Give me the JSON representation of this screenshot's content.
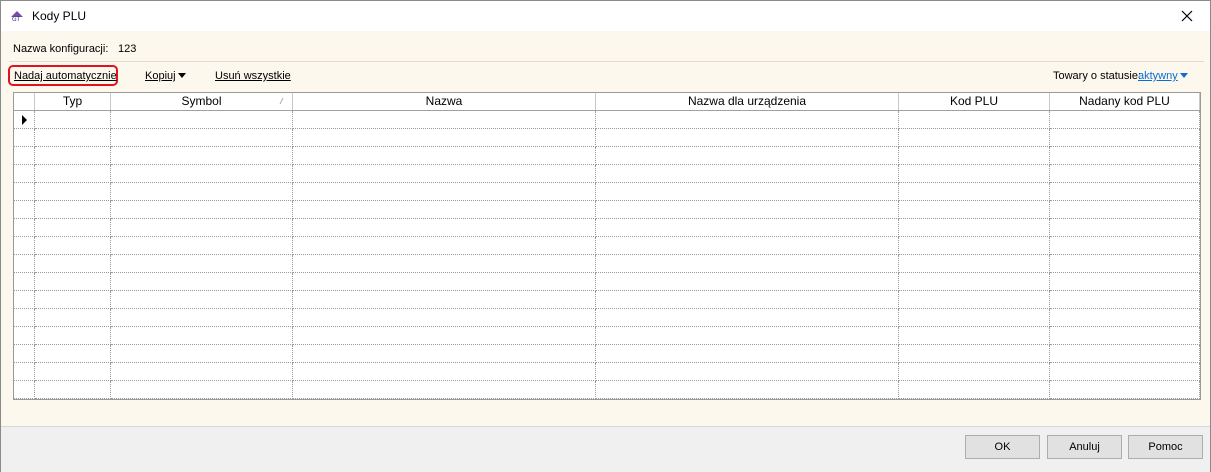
{
  "window": {
    "title": "Kody PLU"
  },
  "config": {
    "label": "Nazwa konfiguracji:",
    "value": "123"
  },
  "toolbar": {
    "assign_auto": "Nadaj automatycznie",
    "copy": "Kopiuj",
    "remove_all": "Usuń wszystkie",
    "status_label": "Towary o statusie:",
    "status_value": "aktywny"
  },
  "grid": {
    "columns": [
      "Typ",
      "Symbol",
      "Nazwa",
      "Nazwa dla urządzenia",
      "Kod PLU",
      "Nadany kod PLU"
    ],
    "rows": [
      [
        "",
        "",
        "",
        "",
        "",
        ""
      ],
      [
        "",
        "",
        "",
        "",
        "",
        ""
      ],
      [
        "",
        "",
        "",
        "",
        "",
        ""
      ],
      [
        "",
        "",
        "",
        "",
        "",
        ""
      ],
      [
        "",
        "",
        "",
        "",
        "",
        ""
      ],
      [
        "",
        "",
        "",
        "",
        "",
        ""
      ],
      [
        "",
        "",
        "",
        "",
        "",
        ""
      ],
      [
        "",
        "",
        "",
        "",
        "",
        ""
      ],
      [
        "",
        "",
        "",
        "",
        "",
        ""
      ],
      [
        "",
        "",
        "",
        "",
        "",
        ""
      ],
      [
        "",
        "",
        "",
        "",
        "",
        ""
      ],
      [
        "",
        "",
        "",
        "",
        "",
        ""
      ],
      [
        "",
        "",
        "",
        "",
        "",
        ""
      ],
      [
        "",
        "",
        "",
        "",
        "",
        ""
      ],
      [
        "",
        "",
        "",
        "",
        "",
        ""
      ],
      [
        "",
        "",
        "",
        "",
        "",
        ""
      ]
    ]
  },
  "buttons": {
    "ok": "OK",
    "cancel": "Anuluj",
    "help": "Pomoc"
  },
  "colors": {
    "highlight": "#e0141e",
    "link": "#0a6ed1",
    "background": "#fdf8ee"
  }
}
